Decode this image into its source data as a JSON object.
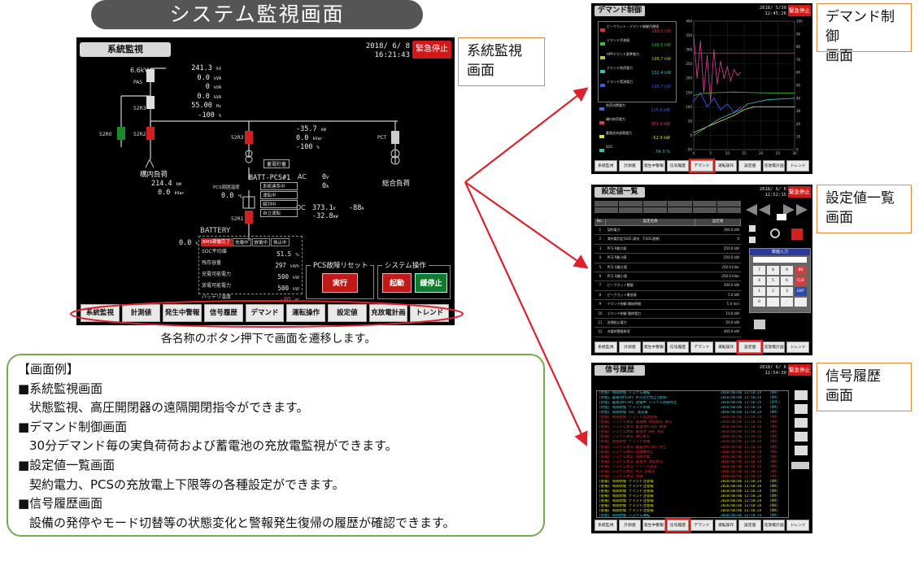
{
  "main_title": "システム監視画面",
  "main_screen": {
    "title": "系統監視",
    "datetime": [
      "2018/ 6/ 8",
      "16:21:43"
    ],
    "emergency_stop": "緊急停止",
    "voltage": "6.6kV",
    "breakers": [
      "PAS",
      "52R3",
      "52R0",
      "52R2",
      "52R3",
      "PCT",
      "52R1"
    ],
    "main_readings": [
      "241.3",
      "0.0",
      "0",
      "0.0",
      "55.00",
      "-100"
    ],
    "main_units": [
      "kV",
      "kVA",
      "kVA",
      "kVA",
      "Hz",
      "%"
    ],
    "load_left": {
      "name": "構内負荷",
      "v1": "214.4",
      "u1": "kW",
      "v2": "0.0",
      "u2": "kVar"
    },
    "load_right": {
      "name": "総合負荷"
    },
    "pcs_readings": [
      "-35.7",
      "0.0",
      "-100"
    ],
    "pcs_units": [
      "kW",
      "kVar",
      "%"
    ],
    "pcs_name": "BATT-PCS#1",
    "ac_label": "AC",
    "ac_value": "0",
    "ac_unit": "V",
    "ac_value2": "0",
    "ac_unit2": "A",
    "dc_label": "DC",
    "dc_value": "373.1",
    "dc_unit": "V",
    "dc_value2": "-32.8",
    "dc_unit2": "kW",
    "dc_value3": "-88",
    "dc_unit3": "A",
    "trans_label": "蓄電貯蓄",
    "pcs_temp_label": "PCS周囲温度",
    "pcs_temp": "0.0",
    "pcs_temp_unit": "℃",
    "pcs_status": [
      "系統連系中",
      "運転中",
      "解列中",
      "自立運転"
    ],
    "battery_title": "BATTERY",
    "battery_val": "0.0",
    "battery_val_unit": "%",
    "battery_tags": [
      "BMS稼働完了",
      "充電中",
      "放電中",
      "休止中"
    ],
    "battery_rows": [
      {
        "label": "SOC平均値",
        "value": "51.5",
        "unit": "%"
      },
      {
        "label": "残存容量",
        "value": "297",
        "unit": "kWh"
      },
      {
        "label": "充電可能電力",
        "value": "500",
        "unit": "kW"
      },
      {
        "label": "放電可能電力",
        "value": "500",
        "unit": "kW"
      },
      {
        "label": "バッテリ温度",
        "value": "-40",
        "unit": "℃"
      }
    ],
    "pcs_reset_group": "PCS故障リセット",
    "pcs_reset_btn": "実行",
    "sys_op_group": "システム操作",
    "start_btn": "起動",
    "stop_btn": "緩停止"
  },
  "nav_buttons": [
    "系統監視",
    "計測値",
    "発生中警報",
    "信号履歴",
    "デマンド",
    "運転操作",
    "設定値",
    "充放電計画",
    "トレンド"
  ],
  "caption": "各名称のボタン押下で画面を遷移します。",
  "callouts": {
    "system": [
      "系統監視",
      "画面"
    ],
    "demand": [
      "デマンド制御",
      "画面"
    ],
    "settings": [
      "設定値一覧",
      "画面"
    ],
    "history": [
      "信号履歴",
      "画面"
    ]
  },
  "demand_screen": {
    "title": "デマンド制御",
    "datetime": [
      "2018/ 5/30",
      "12:45:26"
    ],
    "emergency_stop": "緊急停止",
    "legend": [
      {
        "label": "ピークカット・デマンド制御目標値",
        "value": "288.0",
        "unit": "kW",
        "color": "#e03030"
      },
      {
        "label": "デマンド予測値",
        "value": "148.5",
        "unit": "kW",
        "color": "#30c030"
      },
      {
        "label": "HPPデマンド基準電力",
        "value": "196.7",
        "unit": "kW",
        "color": "#c0c030"
      },
      {
        "label": "デマンド負荷電力",
        "value": "132.4",
        "unit": "kW",
        "color": "#30c0c0"
      },
      {
        "label": "デマンド実測電力",
        "value": "195.7",
        "unit": "kW",
        "color": "#3060e0"
      }
    ],
    "legend2": [
      {
        "label": "負荷消費電力",
        "value": "115.6",
        "unit": "kW",
        "color": "#3070e0"
      },
      {
        "label": "構内負荷電力",
        "value": "362.4",
        "unit": "kW",
        "color": "#e03070"
      },
      {
        "label": "蓄電池充放電電力",
        "value": "-52.9",
        "unit": "kW",
        "color": "#e0e030"
      },
      {
        "label": "SOC",
        "value": "54.0",
        "unit": "%",
        "color": "#30c0c0"
      }
    ],
    "chart_data": {
      "type": "line",
      "x_ticks": [
        "0",
        "5",
        "10",
        "15",
        "20",
        "25",
        "30"
      ],
      "y_left_ticks": [
        "400",
        "350",
        "300",
        "250",
        "200",
        "150",
        "100",
        "50",
        "0",
        "-50"
      ],
      "y_right_ticks": [
        "100",
        "90",
        "80",
        "70",
        "60",
        "50",
        "40",
        "30",
        "20",
        "10",
        "0"
      ],
      "xlim": [
        0,
        30
      ],
      "ylim": [
        -50,
        400
      ],
      "series": [
        {
          "color": "#e040a0",
          "x": [
            0,
            1,
            2,
            3,
            4,
            5,
            6,
            7,
            8,
            9,
            10,
            11,
            12,
            13,
            14
          ],
          "y": [
            350,
            200,
            330,
            150,
            280,
            120,
            300,
            180,
            260,
            200,
            240,
            190,
            230,
            210,
            220
          ]
        },
        {
          "color": "#4060ff",
          "x": [
            0,
            2,
            4,
            6,
            8,
            10,
            12,
            14
          ],
          "y": [
            120,
            150,
            100,
            130,
            90,
            110,
            80,
            100
          ]
        },
        {
          "color": "#30c030",
          "x": [
            0,
            4,
            8,
            12,
            16,
            20,
            24,
            28,
            30
          ],
          "y": [
            140,
            148,
            150,
            152,
            150,
            149,
            148,
            148,
            148
          ]
        },
        {
          "color": "#e0e030",
          "x": [
            0,
            6,
            12,
            15,
            18,
            24,
            30
          ],
          "y": [
            10,
            40,
            70,
            90,
            100,
            100,
            100
          ]
        },
        {
          "color": "#30c0c0",
          "x": [
            0,
            8,
            14,
            16,
            22,
            30
          ],
          "y": [
            0,
            60,
            90,
            110,
            125,
            130
          ]
        },
        {
          "color": "#e03030",
          "x": [
            0,
            30
          ],
          "y": [
            288,
            288
          ]
        }
      ]
    }
  },
  "settings_screen": {
    "title": "設定値一覧",
    "datetime": [
      "2018/ 6/ 6",
      "12:52:15"
    ],
    "emergency_stop": "緊急停止",
    "columns": [
      "No.",
      "設定名称",
      "設定値"
    ],
    "rows": [
      {
        "no": "1",
        "name": "契約電力",
        "value": "300.0",
        "unit": "kW"
      },
      {
        "no": "2",
        "name": "満充電判定(SOC:満充、T:SOC連携)",
        "value": "0",
        "unit": ""
      },
      {
        "no": "3",
        "name": "PCS P最大値",
        "value": "250.0",
        "unit": "kW"
      },
      {
        "no": "4",
        "name": "PCS P最小値",
        "value": "-250.0",
        "unit": "kW"
      },
      {
        "no": "5",
        "name": "PCS Q最大値",
        "value": "250.0",
        "unit": "kVar"
      },
      {
        "no": "6",
        "name": "PCS Q最小値",
        "value": "-250.0",
        "unit": "kVar"
      },
      {
        "no": "7",
        "name": "ピークカット閾値",
        "value": "200.0",
        "unit": "kW"
      },
      {
        "no": "8",
        "name": "ピークカット最低値",
        "value": "5.0",
        "unit": "kW"
      },
      {
        "no": "9",
        "name": "デマンド制御 開始時間",
        "value": "5.0",
        "unit": "min"
      },
      {
        "no": "10",
        "name": "デマンド制御 最終電力",
        "value": "10.0",
        "unit": "kW"
      },
      {
        "no": "11",
        "name": "逆潮防止電力",
        "value": "50.0",
        "unit": "kW"
      },
      {
        "no": "12",
        "name": "充電時閾値負荷",
        "value": "400.0",
        "unit": "kW"
      }
    ],
    "keypad_title": "数値入力",
    "keypad": [
      "7",
      "8",
      "9",
      "BS",
      "4",
      "5",
      "6",
      "CLR",
      "1",
      "2",
      "3",
      "ENT",
      "0",
      ".",
      "-",
      ""
    ]
  },
  "history_screen": {
    "title": "信号履歴",
    "datetime": [
      "2018/ 6/ 6",
      "12:54:30"
    ],
    "emergency_stop": "緊急停止",
    "lines": [
      {
        "text": "[状態] 制御状態 システム運転",
        "time": "2018/06/06 11:58:24",
        "tag": "(ON)",
        "color": "#30d0e0"
      },
      {
        "text": "[状態] 蓄電池PCS#1 PCS完全停止(復帰)",
        "time": "2018/06/06 11:58:24",
        "tag": "(ON)",
        "color": "#30d0e0"
      },
      {
        "text": "[状態] 蓄電池PCS#1 放電中 システム制御停止",
        "time": "2018/06/06 11:58:24",
        "tag": "(OFF)",
        "color": "#30d0e0"
      },
      {
        "text": "[状態] 制御状態 デマンド制御",
        "time": "2018/06/06 11:58:24",
        "tag": "(ON)",
        "color": "#30d0e0"
      },
      {
        "text": "[状態] 制御状態 SOC 満充電",
        "time": "2018/06/06 11:58:24",
        "tag": "(ON)",
        "color": "#30d0e0"
      },
      {
        "text": "[警報] 制御状態 デマンド超過警報",
        "time": "2018/06/06 11:58:24",
        "tag": "(ON)",
        "color": "#e03030"
      },
      {
        "text": "[警報] システム異常 発電機 系統連系 異常",
        "time": "2018/06/06 11:58:24",
        "tag": "(ON)",
        "color": "#e03030"
      },
      {
        "text": "[警報] システム異常 蓄電池PCS#1 故障",
        "time": "2018/06/06 11:58:24",
        "tag": "(ON)",
        "color": "#e03030"
      },
      {
        "text": "[警報] システム異常 蓄電池 BMS 異常",
        "time": "2018/06/06 11:58:24",
        "tag": "(ON)",
        "color": "#e03030"
      },
      {
        "text": "[警報] システム異常 通信異常",
        "time": "2018/06/06 11:58:24",
        "tag": "(ON)",
        "color": "#e03030"
      },
      {
        "text": "[警報] 制御状態 デマンド警報",
        "time": "2018/06/06 11:58:24",
        "tag": "(ON)",
        "color": "#e03030"
      },
      {
        "text": "[警報] システム異常 蓄電池PCS#1 停止",
        "time": "2018/06/06 11:58:24",
        "tag": "(ON)",
        "color": "#e03030"
      },
      {
        "text": "[警報] システム異常 発電機停止",
        "time": "2018/06/06 11:58:24",
        "tag": "(ON)",
        "color": "#e03030"
      },
      {
        "text": "[警報] システム異常 系統停電",
        "time": "2018/06/06 11:58:24",
        "tag": "(ON)",
        "color": "#e03030"
      },
      {
        "text": "[警報] システム異常 蓄電池 温度異常",
        "time": "2018/06/06 11:58:24",
        "tag": "(ON)",
        "color": "#e03030"
      },
      {
        "text": "[警報] システム異常 デマンド超過",
        "time": "2018/06/06 11:58:24",
        "tag": "(ON)",
        "color": "#e03030"
      },
      {
        "text": "[警報] システム異常 PCS 過電流",
        "time": "2018/06/06 11:58:24",
        "tag": "(ON)",
        "color": "#e03030"
      },
      {
        "text": "[警報] システム異常 停電",
        "time": "2018/06/06 11:58:24",
        "tag": "(ON)",
        "color": "#e03030"
      },
      {
        "text": "[警報] 制御状態 デマンド注意報",
        "time": "2018/06/06 11:58:24",
        "tag": "(ON)",
        "color": "#e0e030"
      },
      {
        "text": "[警報] 制御状態 デマンド注意報",
        "time": "2018/06/06 11:58:24",
        "tag": "(ON)",
        "color": "#e0e030"
      },
      {
        "text": "[警報] 制御状態 デマンド注意報",
        "time": "2018/06/06 11:58:24",
        "tag": "(ON)",
        "color": "#e0e030"
      },
      {
        "text": "[警報] 制御状態 デマンド注意報",
        "time": "2018/06/06 11:58:24",
        "tag": "(ON)",
        "color": "#e0e030"
      },
      {
        "text": "[警報] 制御状態 デマンド注意報",
        "time": "2018/06/06 11:58:24",
        "tag": "(ON)",
        "color": "#e0e030"
      },
      {
        "text": "[警報] 制御状態 デマンド注意報",
        "time": "2018/06/06 11:58:24",
        "tag": "(ON)",
        "color": "#e0e030"
      },
      {
        "text": "[警報] 制御状態 デマンド注意報",
        "time": "2018/06/06 11:58:24",
        "tag": "(ON)",
        "color": "#e0e030"
      },
      {
        "text": "[状態] 制御状態 システム運転",
        "time": "2018/06/06 11:58:24",
        "tag": "(ON)",
        "color": "#30d0e0"
      }
    ]
  },
  "description": {
    "header": "【画面例】",
    "items": [
      {
        "title": "■系統監視画面",
        "text": "状態監視、高圧開閉器の遠隔開閉指令ができます。"
      },
      {
        "title": "■デマンド制御画面",
        "text": "30分デマンド毎の実負荷荷および蓄電池の充放電監視ができます。"
      },
      {
        "title": "■設定値一覧画面",
        "text": "契約電力、PCSの充放電上下限等の各種設定ができます。"
      },
      {
        "title": "■信号履歴画面",
        "text": "設備の発停やモード切替等の状態変化と警報発生復帰の履歴が確認できます。"
      }
    ]
  }
}
